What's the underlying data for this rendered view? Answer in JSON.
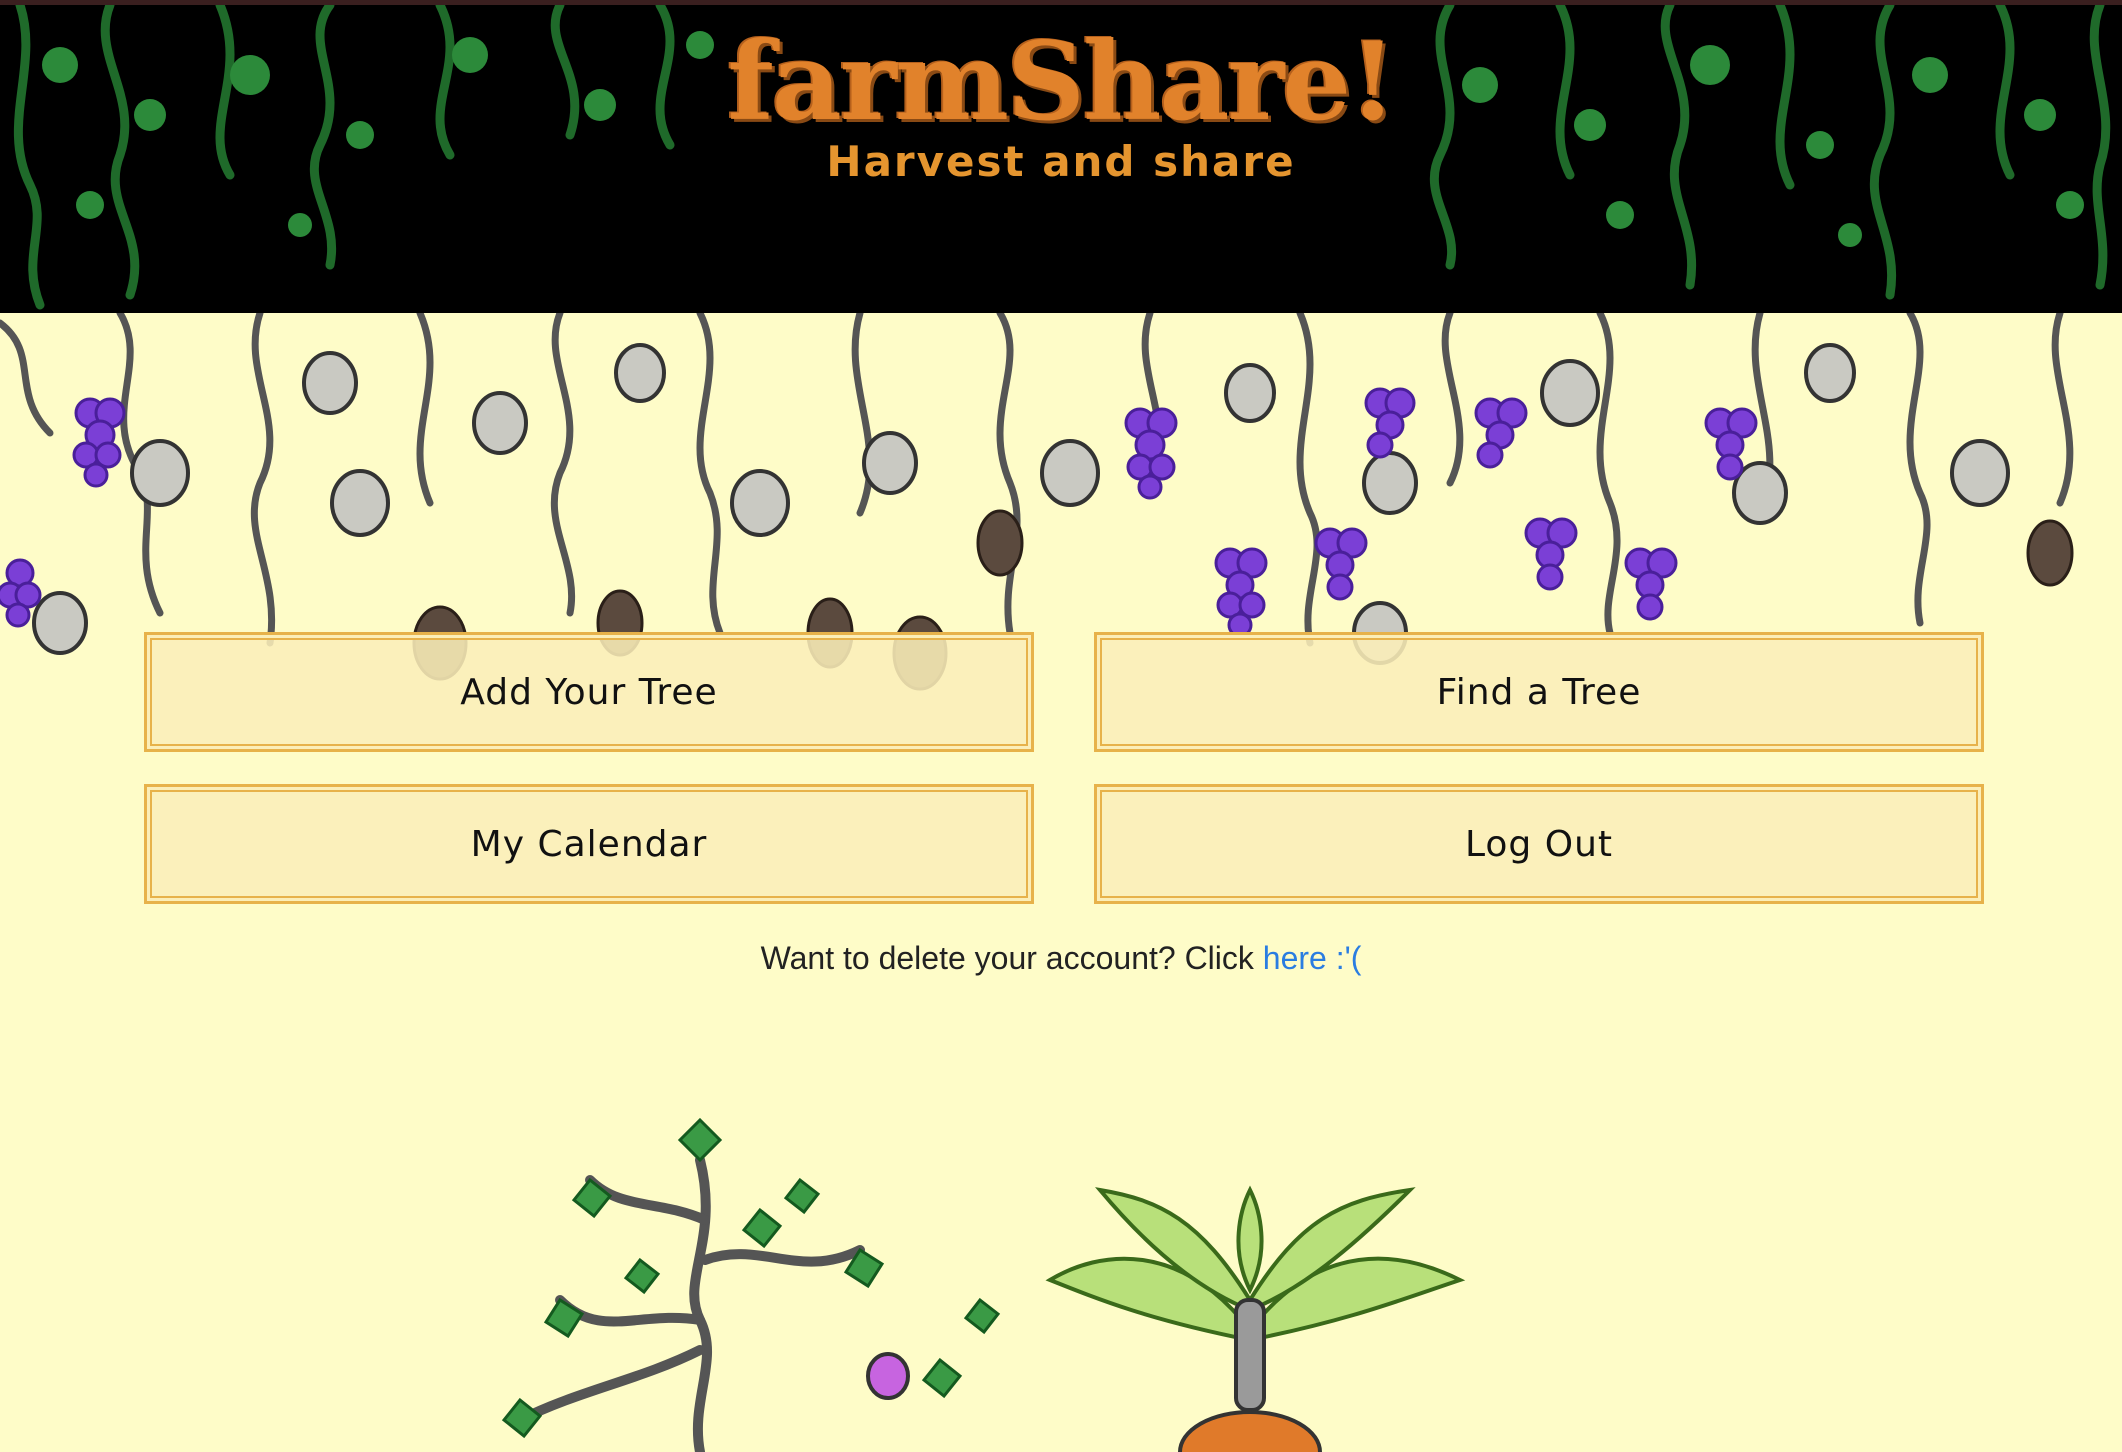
{
  "header": {
    "logo": "farmShare!",
    "tagline": "Harvest and share"
  },
  "nav": {
    "add_tree": "Add Your Tree",
    "find_tree": "Find a Tree",
    "calendar": "My Calendar",
    "logout": "Log Out"
  },
  "account": {
    "prompt": "Want to delete your account? Click ",
    "link": "here :'("
  },
  "colors": {
    "page_bg": "#fefcc8",
    "header_bg": "#000000",
    "logo": "#e1822b",
    "button_bg": "#fbeeb8",
    "button_border": "#e7b24a",
    "link": "#2a7de1",
    "grape": "#7b3fd6",
    "vine": "#1f6a2a"
  },
  "decor": {
    "header_icon": "green-vines-illustration",
    "garden_icon": "hanging-grapes-and-gourds-illustration",
    "tree_icon": "fruit-tree-illustration",
    "plant_icon": "leafy-plant-illustration"
  }
}
